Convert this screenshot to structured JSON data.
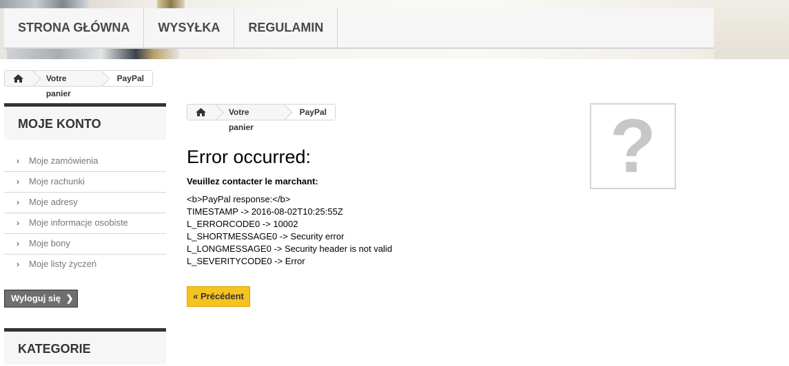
{
  "header": {
    "nav": [
      "STRONA GŁÓWNA",
      "WYSYŁKA",
      "REGULAMIN"
    ]
  },
  "breadcrumb": {
    "home_icon": "home-icon",
    "items": [
      "Votre panier",
      "PayPal"
    ]
  },
  "sidebar": {
    "account_title": "MOJE KONTO",
    "account_items": [
      "Moje zamówienia",
      "Moje rachunki",
      "Moje adresy",
      "Moje informacje osobiste",
      "Moje bony",
      "Moje listy życzeń"
    ],
    "logout_label": "Wyloguj się",
    "categories_title": "KATEGORIE"
  },
  "main": {
    "breadcrumb": [
      "Votre panier",
      "PayPal"
    ],
    "error_title": "Error occurred:",
    "error_subtitle": "Veuillez contacter le marchant:",
    "error_lines": [
      "<b>PayPal response:</b>",
      "TIMESTAMP -> 2016-08-02T10:25:55Z",
      "L_ERRORCODE0 -> 10002",
      "L_SHORTMESSAGE0 -> Security error",
      "L_LONGMESSAGE0 -> Security header is not valid",
      "L_SEVERITYCODE0 -> Error"
    ],
    "prev_button": "« Précédent",
    "placeholder_glyph": "?"
  },
  "colors": {
    "accent_yellow": "#f5c320",
    "dark_bar": "#333333",
    "nav_bg": "#f6f6f6"
  }
}
